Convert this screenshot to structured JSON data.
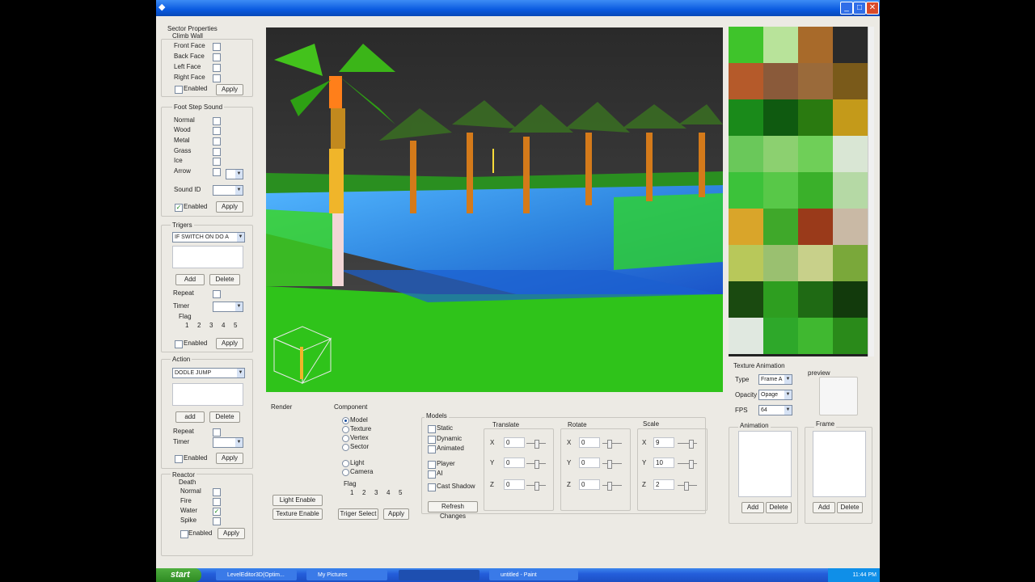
{
  "window": {
    "title": "",
    "min": "_",
    "max": "□",
    "close": "✕"
  },
  "sector": {
    "title": "Sector Properties",
    "climb_wall": "Climb Wall",
    "faces": [
      "Front Face",
      "Back Face",
      "Left Face",
      "Right Face"
    ],
    "enabled": "Enabled",
    "apply": "Apply"
  },
  "footstep": {
    "title": "Foot Step Sound",
    "items": [
      "Normal",
      "Wood",
      "Metal",
      "Grass",
      "Ice",
      "Arrow"
    ],
    "sound_id": "Sound ID",
    "enabled": "Enabled",
    "apply": "Apply"
  },
  "triggers": {
    "title": "Trigers",
    "select_value": "IF SWITCH ON DO A",
    "add": "Add",
    "delete": "Delete",
    "repeat": "Repeat",
    "timer": "Timer",
    "flag": "Flag",
    "flags": [
      "1",
      "2",
      "3",
      "4",
      "5"
    ],
    "enabled": "Enabled",
    "apply": "Apply"
  },
  "action": {
    "title": "Action",
    "select_value": "DODLE JUMP",
    "add": "add",
    "delete": "Delete",
    "repeat": "Repeat",
    "timer": "Timer",
    "enabled": "Enabled",
    "apply": "Apply"
  },
  "reactor": {
    "title": "Reactor",
    "death": "Death",
    "items": [
      "Normal",
      "Fire",
      "Water",
      "Spike"
    ],
    "water_checked": true,
    "enabled": "Enabled",
    "apply": "Apply"
  },
  "render": {
    "title": "Render",
    "light_enable": "Light Enable",
    "texture_enable": "Texture Enable"
  },
  "component": {
    "title": "Component",
    "items": [
      "Model",
      "Texture",
      "Vertex",
      "Sector"
    ],
    "items2": [
      "Light",
      "Camera"
    ],
    "flag": "Flag",
    "flags": [
      "1",
      "2",
      "3",
      "4",
      "5"
    ],
    "triger_select": "Triger Select",
    "apply": "Apply"
  },
  "models": {
    "title": "Models",
    "options": [
      "Static",
      "Dynamic",
      "Animated",
      "Player",
      "AI",
      "Cast Shadow"
    ],
    "refresh": "Refresh Changes"
  },
  "transform": {
    "translate": "Translate",
    "rotate": "Rotate",
    "scale": "Scale",
    "axes": [
      "X",
      "Y",
      "Z"
    ],
    "translate_values": [
      "0",
      "0",
      "0"
    ],
    "rotate_values": [
      "0",
      "0",
      "0"
    ],
    "scale_values": [
      "9",
      "10",
      "2"
    ]
  },
  "texture_animation": {
    "title": "Texture Animation",
    "type_label": "Type",
    "type_value": "Frame A",
    "opacity_label": "Opacity",
    "opacity_value": "Opage",
    "fps_label": "FPS",
    "fps_value": "64",
    "preview": "preview",
    "animation": "Animation",
    "frame": "Frame",
    "add": "Add",
    "delete": "Delete"
  },
  "taskbar": {
    "start": "start",
    "tasks": [
      "LevelEditor3D(Optim...",
      "My Pictures",
      "",
      "untitled - Paint"
    ],
    "clock": "11:44 PM"
  },
  "colors": {
    "titlebar": "#0a5ae0",
    "panel_bg": "#eceae4",
    "grass": "#2fc31a",
    "water": "#2a7fd8",
    "sky": "#2e2e2e"
  }
}
